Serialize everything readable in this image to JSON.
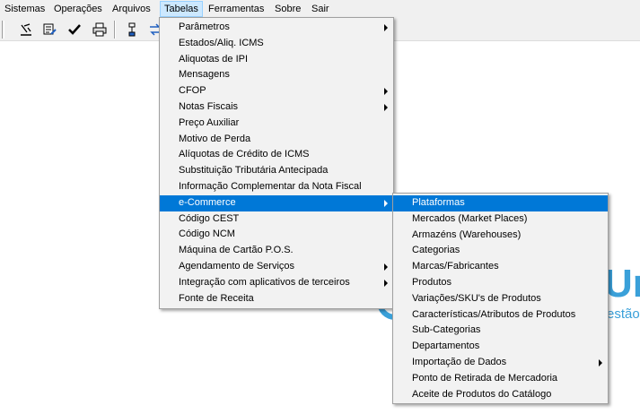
{
  "menubar": {
    "items": [
      "Sistemas",
      "Operações",
      "Arquivos",
      "Tabelas",
      "Ferramentas",
      "Sobre",
      "Sair"
    ],
    "active": "Tabelas"
  },
  "toolbar": {
    "icons": [
      "settings-chart-icon",
      "edit-form-icon",
      "checkmark-icon",
      "printer-icon",
      "flowchart-icon",
      "transfer-icon"
    ]
  },
  "background": {
    "logo_text": "Ur",
    "logo_subtext": "estão"
  },
  "menus": {
    "tabelas": {
      "items": [
        {
          "label": "Parâmetros",
          "submenu": true
        },
        {
          "label": "Estados/Aliq. ICMS",
          "submenu": false
        },
        {
          "label": "Aliquotas de IPI",
          "submenu": false
        },
        {
          "label": "Mensagens",
          "submenu": false
        },
        {
          "label": "CFOP",
          "submenu": true
        },
        {
          "label": "Notas Fiscais",
          "submenu": true
        },
        {
          "label": "Preço  Auxiliar",
          "submenu": false
        },
        {
          "label": "Motivo de Perda",
          "submenu": false
        },
        {
          "label": "Alíquotas de Crédito de ICMS",
          "submenu": false
        },
        {
          "label": "Substituição Tributária Antecipada",
          "submenu": false
        },
        {
          "label": "Informação Complementar da Nota Fiscal",
          "submenu": false
        },
        {
          "label": "e-Commerce",
          "submenu": true,
          "highlighted": true
        },
        {
          "label": "Código CEST",
          "submenu": false
        },
        {
          "label": "Código NCM",
          "submenu": false
        },
        {
          "label": "Máquina de Cartão P.O.S.",
          "submenu": false
        },
        {
          "label": "Agendamento de Serviços",
          "submenu": true
        },
        {
          "label": "Integração com aplicativos de terceiros",
          "submenu": true
        },
        {
          "label": "Fonte de Receita",
          "submenu": false
        }
      ]
    },
    "ecommerce": {
      "items": [
        {
          "label": "Plataformas",
          "submenu": false,
          "highlighted": true
        },
        {
          "label": "Mercados (Market Places)",
          "submenu": false
        },
        {
          "label": "Armazéns (Warehouses)",
          "submenu": false
        },
        {
          "label": "Categorias",
          "submenu": false
        },
        {
          "label": "Marcas/Fabricantes",
          "submenu": false
        },
        {
          "label": "Produtos",
          "submenu": false
        },
        {
          "label": "Variações/SKU's de Produtos",
          "submenu": false
        },
        {
          "label": "Características/Atributos de Produtos",
          "submenu": false
        },
        {
          "label": "Sub-Categorias",
          "submenu": false
        },
        {
          "label": "Departamentos",
          "submenu": false
        },
        {
          "label": "Importação de Dados",
          "submenu": true
        },
        {
          "label": "Ponto de Retirada de Mercadoria",
          "submenu": false
        },
        {
          "label": "Aceite de Produtos do Catálogo",
          "submenu": false
        }
      ]
    }
  },
  "colors": {
    "highlight": "#0078d7",
    "menubar_active": "#cce8ff",
    "logo": "#3aa0d9"
  }
}
